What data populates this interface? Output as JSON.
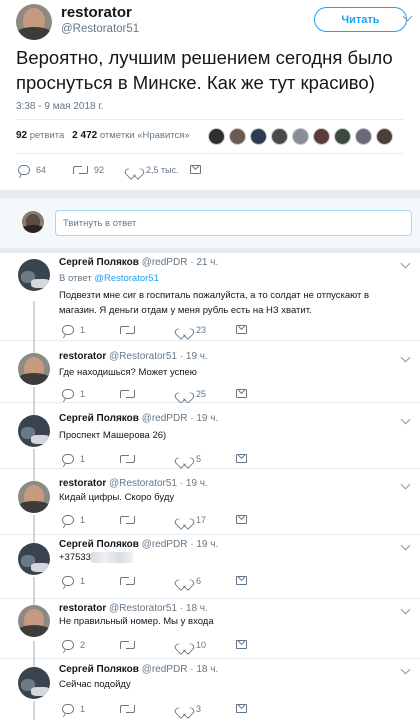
{
  "tweet": {
    "author_name": "restorator",
    "author_handle": "@Restorator51",
    "follow_label": "Читать",
    "text": "Вероятно, лучшим решением сегодня было проснуться в Минске. Как же тут красиво)",
    "date": "3:38 - 9 мая 2018 г.",
    "retweets_count": "92",
    "retweets_label": "ретвита",
    "likes_count": "2 472",
    "likes_label": "отметки «Нравится»",
    "likers_count": 9,
    "replies": "64",
    "retweets": "92",
    "likes": "2,5 тыс."
  },
  "reply_box": {
    "placeholder": "Твитнуть в ответ"
  },
  "thread": [
    {
      "name": "Сергей Поляков",
      "handle": "@redPDR",
      "time": "21 ч.",
      "reply_to_label": "В ответ",
      "reply_to": "@Restorator51",
      "text": "Подвезти мне сиг в госпиталь пожалуйста, а то солдат не отпускают в магазин. Я деньги отдам у меня рубль есть на НЗ хватит.",
      "replies": "1",
      "retweets": "",
      "likes": "23"
    },
    {
      "name": "restorator",
      "handle": "@Restorator51",
      "time": "19 ч.",
      "text": "Где находишься? Может успею",
      "replies": "1",
      "retweets": "",
      "likes": "25"
    },
    {
      "name": "Сергей Поляков",
      "handle": "@redPDR",
      "time": "19 ч.",
      "text": "Проспект Машерова 26)",
      "replies": "1",
      "retweets": "",
      "likes": "5"
    },
    {
      "name": "restorator",
      "handle": "@Restorator51",
      "time": "19 ч.",
      "text": "Кидай цифры. Скоро буду",
      "replies": "1",
      "retweets": "",
      "likes": "17"
    },
    {
      "name": "Сергей Поляков",
      "handle": "@redPDR",
      "time": "19 ч.",
      "text": "+37533",
      "replies": "1",
      "retweets": "",
      "likes": "6"
    },
    {
      "name": "restorator",
      "handle": "@Restorator51",
      "time": "18 ч.",
      "text": "Не правильный номер. Мы у входа",
      "replies": "2",
      "retweets": "",
      "likes": "10"
    },
    {
      "name": "Сергей Поляков",
      "handle": "@redPDR",
      "time": "18 ч.",
      "text": "Сейчас подойду",
      "replies": "1",
      "retweets": "",
      "likes": "3"
    }
  ],
  "separator": "·",
  "colors": {
    "accent": "#1da1f2",
    "muted": "#657786",
    "border": "#e6ecf0"
  },
  "icons": [
    "reply-icon",
    "retweet-icon",
    "heart-icon",
    "mail-icon",
    "chevron-down-icon"
  ]
}
